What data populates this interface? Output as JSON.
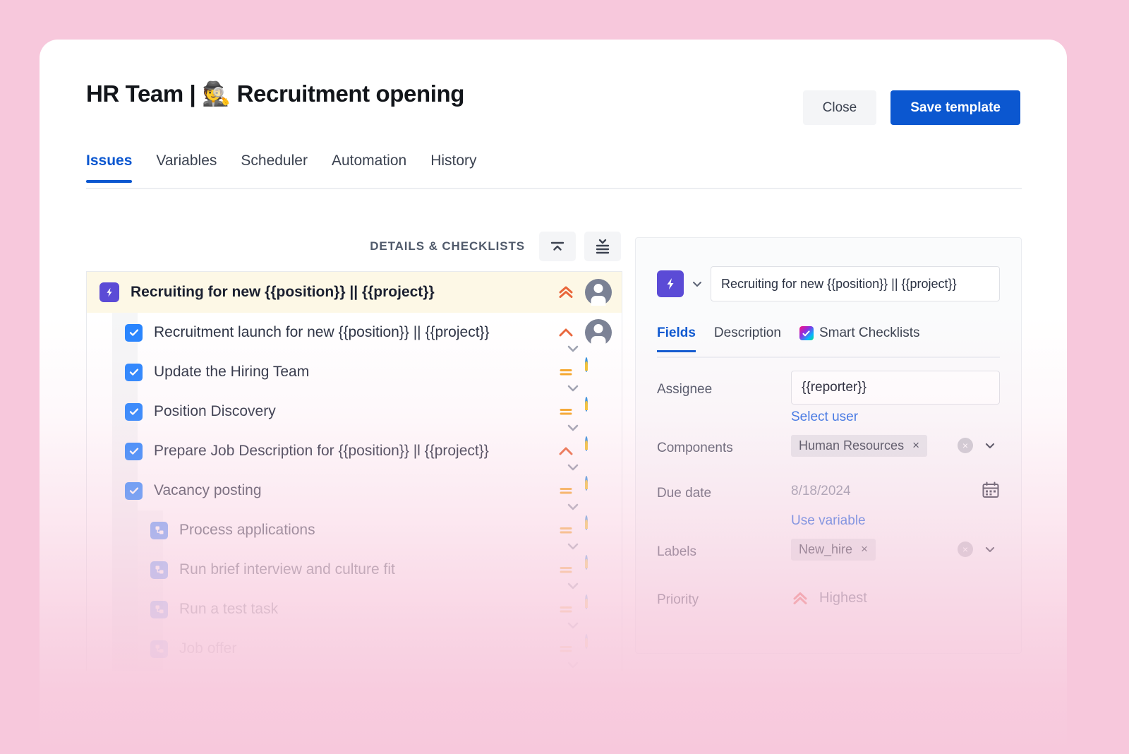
{
  "header": {
    "title": "HR Team | 🕵️ Recruitment opening",
    "close_label": "Close",
    "save_label": "Save template"
  },
  "tabs": [
    {
      "label": "Issues",
      "active": true
    },
    {
      "label": "Variables",
      "active": false
    },
    {
      "label": "Scheduler",
      "active": false
    },
    {
      "label": "Automation",
      "active": false
    },
    {
      "label": "History",
      "active": false
    }
  ],
  "checklist": {
    "section_title": "DETAILS & CHECKLISTS",
    "collapse_all_icon": "collapse-all-icon",
    "expand_all_icon": "expand-all-icon",
    "rows": [
      {
        "title": "Recruiting for new {{position}} || {{project}}",
        "icon": "bolt-icon",
        "type": "epic",
        "priority": "highest",
        "avatar": "default-user",
        "depth": 0,
        "opacity": 1.0,
        "expander": false
      },
      {
        "title": "Recruitment launch for new {{position}} || {{project}}",
        "icon": "checkbox-icon",
        "type": "task",
        "priority": "high",
        "avatar": "default-user",
        "depth": 1,
        "opacity": 1.0,
        "expander": true
      },
      {
        "title": "Update the Hiring Team",
        "icon": "checkbox-icon",
        "type": "task",
        "priority": "medium",
        "avatar": "photo-user",
        "depth": 1,
        "opacity": 1.0,
        "expander": true
      },
      {
        "title": "Position Discovery",
        "icon": "checkbox-icon",
        "type": "task",
        "priority": "medium",
        "avatar": "photo-user",
        "depth": 1,
        "opacity": 1.0,
        "expander": true
      },
      {
        "title": "Prepare Job Description for {{position}} |l {{project}}",
        "icon": "checkbox-icon",
        "type": "task",
        "priority": "high",
        "avatar": "photo-user",
        "depth": 1,
        "opacity": 1.0,
        "expander": true
      },
      {
        "title": "Vacancy posting",
        "icon": "checkbox-icon",
        "type": "task",
        "priority": "medium",
        "avatar": "photo-user",
        "depth": 1,
        "opacity": 0.92,
        "expander": true
      },
      {
        "title": "Process applications",
        "icon": "subtask-icon",
        "type": "subtask",
        "priority": "medium",
        "avatar": "photo-user",
        "depth": 2,
        "opacity": 0.78,
        "expander": true
      },
      {
        "title": "Run brief interview and culture fit",
        "icon": "subtask-icon",
        "type": "subtask",
        "priority": "medium",
        "avatar": "photo-user",
        "depth": 2,
        "opacity": 0.62,
        "expander": true
      },
      {
        "title": "Run a test task",
        "icon": "subtask-icon",
        "type": "subtask",
        "priority": "medium",
        "avatar": "photo-user",
        "depth": 2,
        "opacity": 0.45,
        "expander": true
      },
      {
        "title": "Job offer",
        "icon": "subtask-icon",
        "type": "subtask",
        "priority": "medium",
        "avatar": "photo-user",
        "depth": 2,
        "opacity": 0.3,
        "expander": true
      }
    ]
  },
  "panel": {
    "issue_type_icon": "bolt-icon",
    "type_chevron_icon": "chevron-down-icon",
    "summary_value": "Recruiting for new {{position}} || {{project}}",
    "tabs": [
      {
        "label": "Fields",
        "active": true,
        "icon": null
      },
      {
        "label": "Description",
        "active": false,
        "icon": null
      },
      {
        "label": "Smart Checklists",
        "active": false,
        "icon": "smart-checklist-icon"
      }
    ],
    "fields": {
      "assignee": {
        "label": "Assignee",
        "value": "{{reporter}}",
        "link": "Select user"
      },
      "components": {
        "label": "Components",
        "chip": "Human Resources",
        "chip_remove": "×",
        "clear_icon": "clear-icon",
        "chevron_icon": "chevron-down-icon"
      },
      "due_date": {
        "label": "Due date",
        "value": "8/18/2024",
        "link": "Use variable",
        "calendar_icon": "calendar-icon"
      },
      "labels": {
        "label": "Labels",
        "chip": "New_hire",
        "chip_remove": "×",
        "clear_icon": "clear-icon",
        "chevron_icon": "chevron-down-icon"
      },
      "priority": {
        "label": "Priority",
        "value": "Highest",
        "icon": "priority-highest-icon"
      }
    }
  },
  "colors": {
    "page_background": "#f7c8dc",
    "accent_blue": "#0b57d0",
    "epic_row_bg": "#fdf8e6",
    "bolt_purple": "#5b4bd6",
    "checkbox_blue": "#2684ff",
    "priority_high": "#e9663a",
    "priority_medium": "#f5a623"
  }
}
